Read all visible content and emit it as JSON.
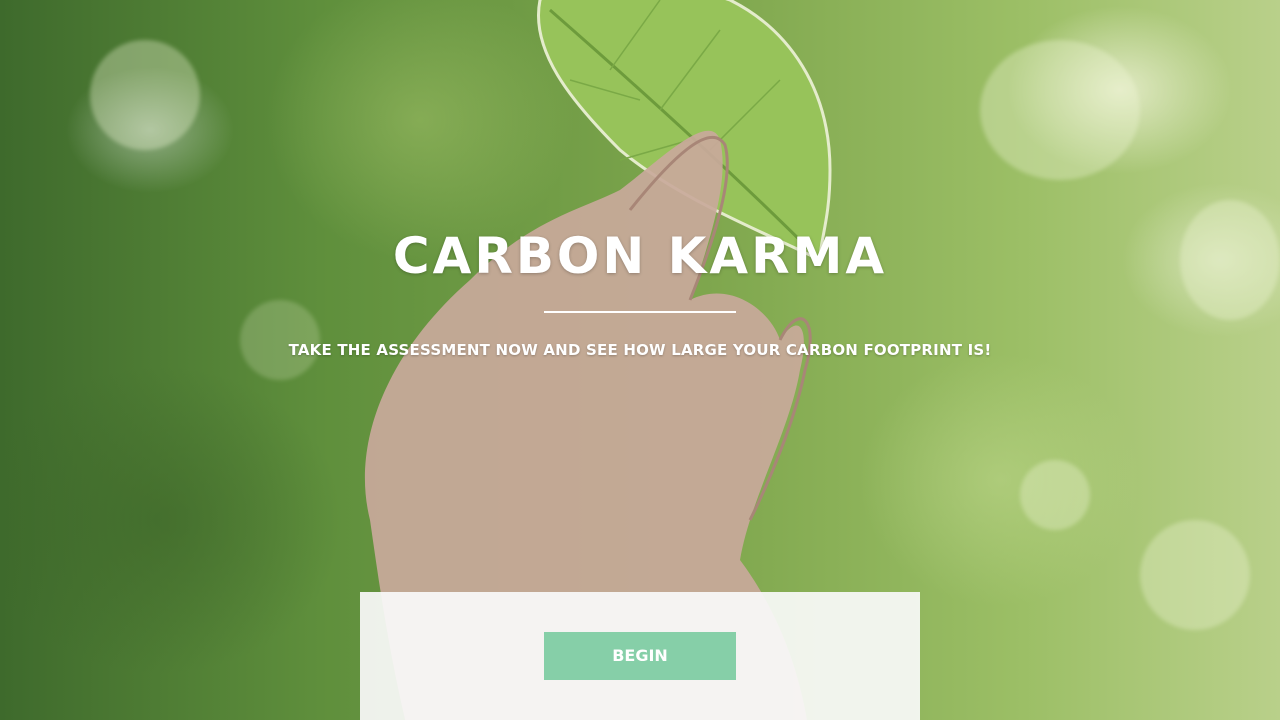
{
  "hero": {
    "title": "CARBON KARMA",
    "subtitle": "TAKE THE ASSESSMENT NOW AND SEE HOW LARGE YOUR CARBON FOOTPRINT IS!"
  },
  "panel": {
    "begin_label": "BEGIN"
  },
  "colors": {
    "button": "#86cfa8",
    "text": "#ffffff"
  }
}
